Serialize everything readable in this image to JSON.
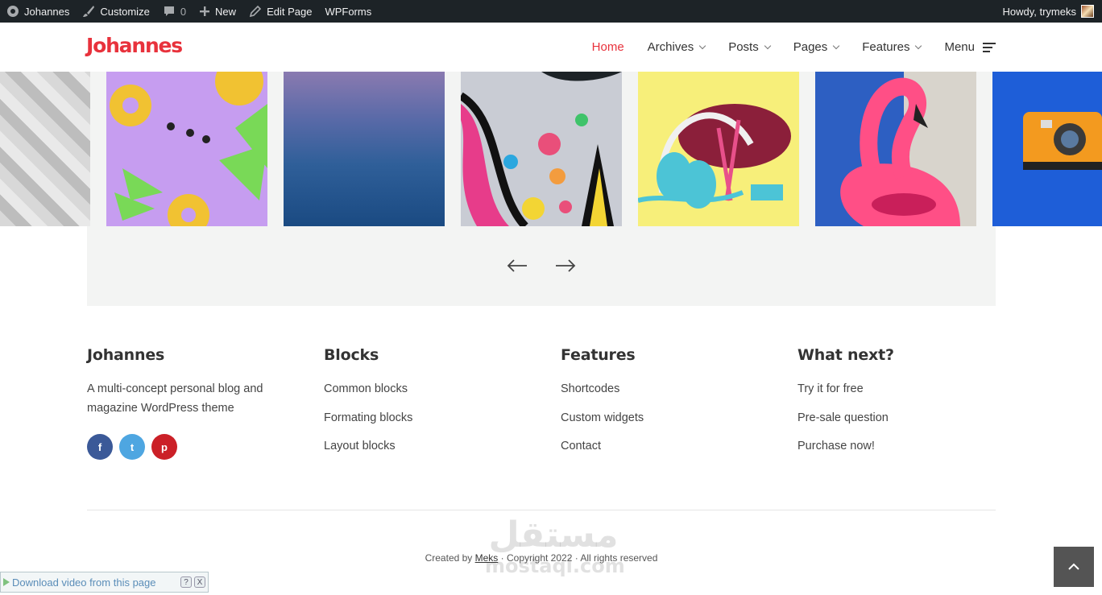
{
  "adminbar": {
    "site_name": "Johannes",
    "customize": "Customize",
    "comments_count": "0",
    "new": "New",
    "edit_page": "Edit Page",
    "wpforms": "WPForms",
    "greeting": "Howdy, trymeks"
  },
  "header": {
    "logo": "Johannes",
    "nav": [
      {
        "label": "Home",
        "active": true
      },
      {
        "label": "Archives"
      },
      {
        "label": "Posts"
      },
      {
        "label": "Pages"
      },
      {
        "label": "Features"
      },
      {
        "label": "Menu"
      }
    ]
  },
  "footer": {
    "col1": {
      "title": "Johannes",
      "text": "A multi-concept personal blog and magazine WordPress theme",
      "social": [
        "f",
        "t",
        "p"
      ]
    },
    "col2": {
      "title": "Blocks",
      "links": [
        "Common blocks",
        "Formating blocks",
        "Layout blocks"
      ]
    },
    "col3": {
      "title": "Features",
      "links": [
        "Shortcodes",
        "Custom widgets",
        "Contact"
      ]
    },
    "col4": {
      "title": "What next?",
      "links": [
        "Try it for free",
        "Pre-sale question",
        "Purchase now!"
      ]
    },
    "copyright_prefix": "Created by ",
    "copyright_author": "Meks",
    "copyright_suffix": " · Copyright 2022 · All rights reserved"
  },
  "watermark": {
    "line1": "مستقل",
    "line2": "mostaql.com"
  },
  "download_bar": {
    "text": "Download video from this page",
    "help": "?",
    "close": "X"
  },
  "colors": {
    "accent": "#e8323c",
    "admin_bar": "#1d2327",
    "slider_bg": "#f3f4f3",
    "facebook": "#3b5998",
    "twitter": "#4ea6e1",
    "pinterest": "#cb2027"
  }
}
